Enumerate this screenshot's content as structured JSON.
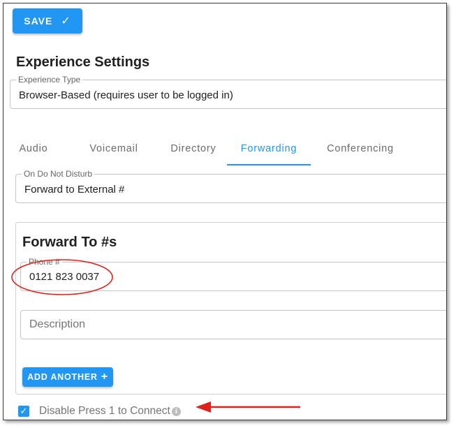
{
  "toolbar": {
    "save_label": "SAVE",
    "save_icon": "check-icon"
  },
  "section_title": "Experience Settings",
  "experience_type": {
    "legend": "Experience Type",
    "value": "Browser-Based (requires user to be logged in)"
  },
  "tabs": [
    {
      "label": "Audio",
      "active": false
    },
    {
      "label": "Voicemail",
      "active": false
    },
    {
      "label": "Directory",
      "active": false
    },
    {
      "label": "Forwarding",
      "active": true
    },
    {
      "label": "Conferencing",
      "active": false
    }
  ],
  "on_dnd": {
    "legend": "On Do Not Disturb",
    "value": "Forward to External #"
  },
  "forward_card": {
    "title": "Forward To #s",
    "phone": {
      "legend": "Phone #",
      "value": "0121 823 0037"
    },
    "description": {
      "placeholder": "Description"
    },
    "add_label": "ADD ANOTHER",
    "add_icon": "+"
  },
  "disable_press": {
    "label": "Disable Press 1 to Connect",
    "checked": true
  },
  "colors": {
    "accent": "#2196f3",
    "annotation": "#e0201b"
  }
}
